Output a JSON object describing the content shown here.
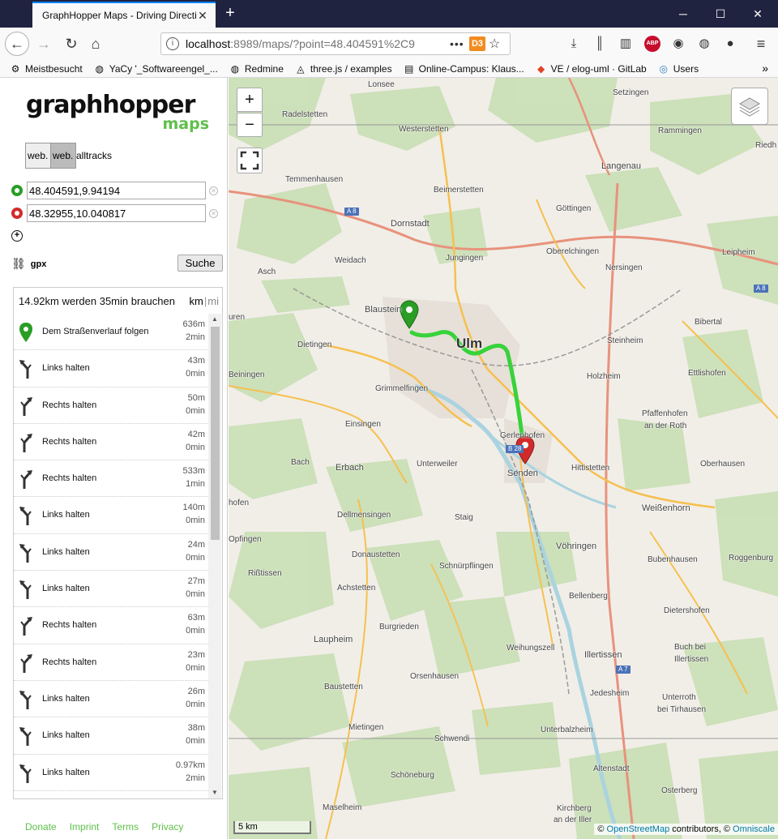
{
  "tab": {
    "title": "GraphHopper Maps - Driving Directions"
  },
  "url": {
    "host": "localhost",
    "rest": ":8989/maps/?point=48.404591%2C9"
  },
  "bookmarks": [
    {
      "label": "Meistbesucht",
      "icon": "gear-icon"
    },
    {
      "label": "YaCy '_Softwareengel_...",
      "icon": "globe-icon"
    },
    {
      "label": "Redmine",
      "icon": "globe-icon"
    },
    {
      "label": "three.js / examples",
      "icon": "threejs-icon"
    },
    {
      "label": "Online-Campus: Klaus...",
      "icon": "page-icon"
    },
    {
      "label": "VE / elog-uml · GitLab",
      "icon": "gitlab-icon"
    },
    {
      "label": "Users",
      "icon": "users-icon"
    }
  ],
  "logo": {
    "main": "graphhopper",
    "sub": "maps"
  },
  "vehicles": {
    "btn1": "web.",
    "btn2": "web.",
    "text": "alltracks"
  },
  "points": {
    "from": "48.404591,9.94194",
    "to": "48.32955,10.040817"
  },
  "gpx_label": "gpx",
  "search_label": "Suche",
  "summary": "14.92km werden 35min brauchen",
  "units": {
    "km": "km",
    "mi": "mi"
  },
  "instructions": [
    {
      "icon": "start-marker-icon",
      "text": "Dem Straßenverlauf folgen",
      "dist": "636m",
      "time": "2min"
    },
    {
      "icon": "keep-left-icon",
      "text": "Links halten",
      "dist": "43m",
      "time": "0min"
    },
    {
      "icon": "keep-right-icon",
      "text": "Rechts halten",
      "dist": "50m",
      "time": "0min"
    },
    {
      "icon": "keep-right-icon",
      "text": "Rechts halten",
      "dist": "42m",
      "time": "0min"
    },
    {
      "icon": "keep-right-icon",
      "text": "Rechts halten",
      "dist": "533m",
      "time": "1min"
    },
    {
      "icon": "keep-left-icon",
      "text": "Links halten",
      "dist": "140m",
      "time": "0min"
    },
    {
      "icon": "keep-left-icon",
      "text": "Links halten",
      "dist": "24m",
      "time": "0min"
    },
    {
      "icon": "keep-left-icon",
      "text": "Links halten",
      "dist": "27m",
      "time": "0min"
    },
    {
      "icon": "keep-right-icon",
      "text": "Rechts halten",
      "dist": "63m",
      "time": "0min"
    },
    {
      "icon": "keep-right-icon",
      "text": "Rechts halten",
      "dist": "23m",
      "time": "0min"
    },
    {
      "icon": "keep-left-icon",
      "text": "Links halten",
      "dist": "26m",
      "time": "0min"
    },
    {
      "icon": "keep-left-icon",
      "text": "Links halten",
      "dist": "38m",
      "time": "0min"
    },
    {
      "icon": "keep-left-icon",
      "text": "Links halten",
      "dist": "0.97km",
      "time": "2min"
    }
  ],
  "footer": {
    "donate": "Donate",
    "imprint": "Imprint",
    "terms": "Terms",
    "privacy": "Privacy"
  },
  "map": {
    "scale": "5 km",
    "attrib_prefix": "©",
    "attrib_osm": "OpenStreetMap",
    "attrib_mid": "contributors, ©",
    "attrib_omni": "Omniscale",
    "labels": {
      "lonsee": "Lonsee",
      "setzingen": "Setzingen",
      "radelstetten": "Radelstetten",
      "westerstetten": "Westerstetten",
      "rammingen": "Rammingen",
      "riedh": "Riedh",
      "temmenhausen": "Temmenhausen",
      "beimerstetten": "Beimerstetten",
      "langenau": "Langenau",
      "dornstadt": "Dornstadt",
      "gottingen": "Göttingen",
      "obereichingen": "Oberelchingen",
      "leipheim": "Leipheim",
      "asch": "Asch",
      "weidach": "Weidach",
      "jungingen": "Jungingen",
      "nersingen": "Nersingen",
      "blaustein": "Blaustein",
      "bibertal": "Bibertal",
      "uren": "uren",
      "dietingen": "Dietingen",
      "ulm": "Ulm",
      "steinheim": "Steinheim",
      "beiningen": "Beiningen",
      "holzheim": "Holzheim",
      "ettlishofen": "Ettlishofen",
      "grimmelfingen": "Grimmelfingen",
      "pfaffenhofen": "Pfaffenhofen",
      "anderroth": "an der Roth",
      "einsingen": "Einsingen",
      "gerlenhofen": "Gerlenhofen",
      "bach": "Bach",
      "erbach": "Erbach",
      "unterweiler": "Unterweiler",
      "senden": "Senden",
      "hittistetten": "Hittistetten",
      "oberhausen": "Oberhausen",
      "hofen": "hofen",
      "dellmensingen": "Dellmensingen",
      "staig": "Staig",
      "weissenhorn": "Weißenhorn",
      "opfingen": "Opfingen",
      "vohringen": "Vöhringen",
      "donaustetten": "Donaustetten",
      "bubenhausen": "Bubenhausen",
      "roggenburg": "Roggenburg",
      "rissen": "Rißtissen",
      "schnurpflingen": "Schnürpflingen",
      "achstetten": "Achstetten",
      "bellenberg": "Bellenberg",
      "dietershofen": "Dietershofen",
      "burgrieden": "Burgrieden",
      "laupheim": "Laupheim",
      "weihungszell": "Weihungszell",
      "illertissen": "Illertissen",
      "buchbei": "Buch bei",
      "illertissen2": "Illertissen",
      "orsenhausen": "Orsenhausen",
      "baustetten": "Baustetten",
      "jedesheim": "Jedesheim",
      "unterroth": "Unterroth",
      "beitirhausen": "bei Tirhausen",
      "mietingen": "Mietingen",
      "schwendi": "Schwendi",
      "unterbalzheim": "Unterbalzheim",
      "altenstadt": "Altenstadt",
      "schoneburg": "Schöneburg",
      "osterberg": "Osterberg",
      "maselheim": "Maselheim",
      "kirchberg": "Kirchberg",
      "anderiller": "an der Iller"
    },
    "shields": {
      "a8": "A 8",
      "a8b": "A 8",
      "a7": "A 7",
      "b28": "B 28"
    }
  },
  "colors": {
    "accent": "#5ec04b",
    "route": "#38d23a",
    "start": "#2a9d25",
    "end": "#d22a2a"
  }
}
